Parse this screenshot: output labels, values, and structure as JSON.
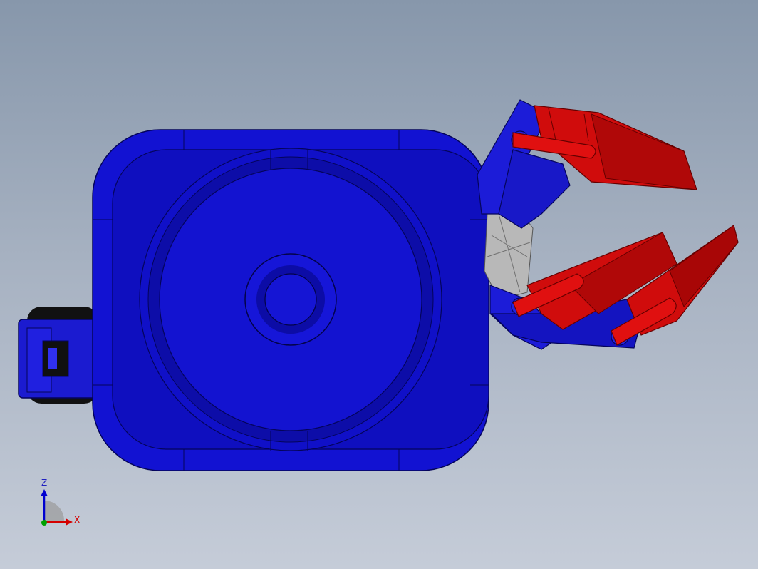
{
  "viewport": {
    "colors": {
      "base_blue": "#1414d6",
      "dark_blue": "#0a0a8c",
      "finger_red": "#d40a0a",
      "dark_red": "#7a0000",
      "gray_part": "#b9b9b9",
      "axis_x": "#d40000",
      "axis_y": "#00a000",
      "axis_z": "#0000d0"
    }
  },
  "triad": {
    "z_label": "Z",
    "x_label": "X"
  }
}
